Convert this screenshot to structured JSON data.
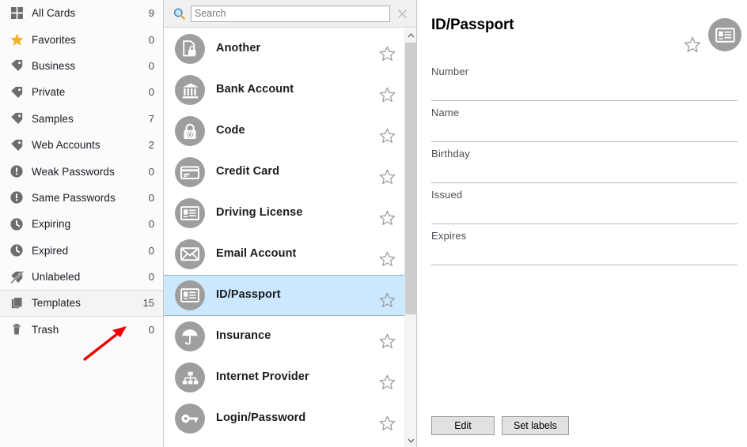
{
  "sidebar": {
    "items": [
      {
        "icon": "grid-icon",
        "label": "All Cards",
        "count": "9",
        "selected": false
      },
      {
        "icon": "star-icon",
        "label": "Favorites",
        "count": "0",
        "selected": false
      },
      {
        "icon": "tag-icon",
        "label": "Business",
        "count": "0",
        "selected": false
      },
      {
        "icon": "tag-icon",
        "label": "Private",
        "count": "0",
        "selected": false
      },
      {
        "icon": "tag-icon",
        "label": "Samples",
        "count": "7",
        "selected": false
      },
      {
        "icon": "tag-icon",
        "label": "Web Accounts",
        "count": "2",
        "selected": false
      },
      {
        "icon": "alert-icon",
        "label": "Weak Passwords",
        "count": "0",
        "selected": false
      },
      {
        "icon": "alert-icon",
        "label": "Same Passwords",
        "count": "0",
        "selected": false
      },
      {
        "icon": "clock-icon",
        "label": "Expiring",
        "count": "0",
        "selected": false
      },
      {
        "icon": "clock-icon",
        "label": "Expired",
        "count": "0",
        "selected": false
      },
      {
        "icon": "tag-off-icon",
        "label": "Unlabeled",
        "count": "0",
        "selected": false
      },
      {
        "icon": "templates-icon",
        "label": "Templates",
        "count": "15",
        "selected": true
      },
      {
        "icon": "trash-icon",
        "label": "Trash",
        "count": "0",
        "selected": false
      }
    ],
    "annotation": {
      "name": "red-arrow",
      "color": "#ee0000"
    }
  },
  "search": {
    "icon": "search-icon",
    "placeholder": "Search",
    "value": "",
    "clear_icon": "close-icon"
  },
  "list": {
    "scrollbar": {
      "up_glyph": "⌃",
      "down_glyph": "⌄"
    },
    "items": [
      {
        "icon": "document-lock-icon",
        "label": "Another",
        "starred": false,
        "selected": false
      },
      {
        "icon": "bank-icon",
        "label": "Bank Account",
        "starred": false,
        "selected": false
      },
      {
        "icon": "padlock-icon",
        "label": "Code",
        "starred": false,
        "selected": false
      },
      {
        "icon": "credit-card-icon",
        "label": "Credit Card",
        "starred": false,
        "selected": false
      },
      {
        "icon": "id-card-icon",
        "label": "Driving License",
        "starred": false,
        "selected": false
      },
      {
        "icon": "envelope-icon",
        "label": "Email Account",
        "starred": false,
        "selected": false
      },
      {
        "icon": "id-card-icon",
        "label": "ID/Passport",
        "starred": false,
        "selected": true
      },
      {
        "icon": "umbrella-icon",
        "label": "Insurance",
        "starred": false,
        "selected": false
      },
      {
        "icon": "network-icon",
        "label": "Internet Provider",
        "starred": false,
        "selected": false
      },
      {
        "icon": "key-icon",
        "label": "Login/Password",
        "starred": false,
        "selected": false
      }
    ]
  },
  "detail": {
    "title": "ID/Passport",
    "avatar_icon": "id-card-icon",
    "star_icon": "star-outline-icon",
    "fields": [
      {
        "label": "Number",
        "value": ""
      },
      {
        "label": "Name",
        "value": ""
      },
      {
        "label": "Birthday",
        "value": ""
      },
      {
        "label": "Issued",
        "value": ""
      },
      {
        "label": "Expires",
        "value": ""
      }
    ],
    "buttons": [
      {
        "name": "edit-button",
        "label": "Edit"
      },
      {
        "name": "set-labels-button",
        "label": "Set labels"
      }
    ]
  },
  "colors": {
    "selection_blue": "#cce8ff",
    "selection_border": "#8db7da",
    "avatar_gray": "#9e9e9e",
    "sidebar_bg": "#fbfbfd",
    "annotation_red": "#ee0000"
  }
}
